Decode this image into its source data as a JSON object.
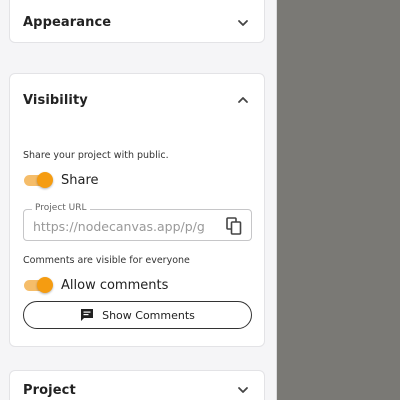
{
  "sidebar": {
    "appearance": {
      "title": "Appearance",
      "icon": "chevron-down-icon"
    },
    "visibility": {
      "title": "Visibility",
      "icon": "chevron-up-icon",
      "share_description": "Share your project with public.",
      "share_toggle": {
        "label": "Share",
        "on": true
      },
      "project_url": {
        "label": "Project URL",
        "value": "https://nodecanvas.app/p/g",
        "copy_icon": "copy-icon"
      },
      "comments_description": "Comments are visible for everyone",
      "comments_toggle": {
        "label": "Allow comments",
        "on": true
      },
      "show_comments_button": {
        "label": "Show Comments",
        "icon": "comment-icon"
      }
    },
    "project": {
      "title": "Project",
      "icon": "chevron-down-icon"
    }
  },
  "colors": {
    "accent": "#f59c11",
    "accent_track": "#f5bd6a",
    "canvas": "#7a7975"
  }
}
